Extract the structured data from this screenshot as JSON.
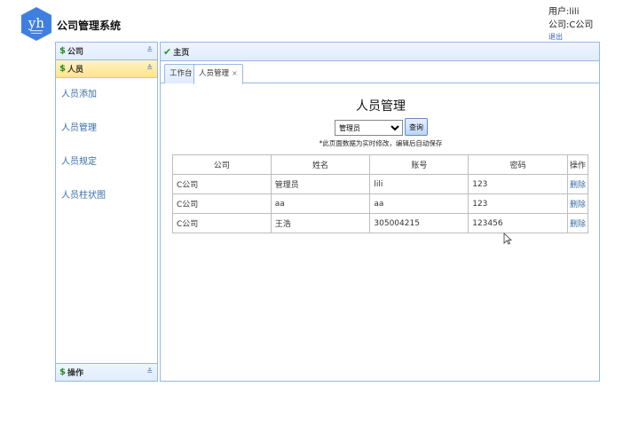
{
  "header": {
    "logo_text": "yh",
    "app_title": "公司管理系统",
    "user_label": "用户:lili",
    "company_label": "公司:C公司",
    "logout_label": "退出"
  },
  "sidebar": {
    "sections": [
      {
        "label": "公司"
      },
      {
        "label": "人员"
      },
      {
        "label": "操作"
      }
    ],
    "items": [
      {
        "label": "人员添加"
      },
      {
        "label": "人员管理"
      },
      {
        "label": "人员规定"
      },
      {
        "label": "人员柱状图"
      }
    ]
  },
  "main": {
    "panel_title": "主页",
    "tabs": [
      {
        "label": "工作台"
      },
      {
        "label": "人员管理",
        "close": "×"
      }
    ],
    "heading": "人员管理",
    "role_select": {
      "selected": "管理员"
    },
    "query_label": "查询",
    "hint": "*此页面数据为实时修改，编辑后自动保存",
    "table": {
      "columns": [
        "公司",
        "姓名",
        "账号",
        "密码",
        "操作"
      ],
      "rows": [
        {
          "company": "C公司",
          "name": "管理员",
          "account": "lili",
          "password": "123",
          "action": "删除"
        },
        {
          "company": "C公司",
          "name": "aa",
          "account": "aa",
          "password": "123",
          "action": "删除"
        },
        {
          "company": "C公司",
          "name": "王浩",
          "account": "305004215",
          "password": "123456",
          "action": "删除"
        }
      ]
    }
  },
  "colors": {
    "panel_border": "#95b8e7",
    "active_section": "#ffe48d",
    "link": "#3a6ea5"
  }
}
